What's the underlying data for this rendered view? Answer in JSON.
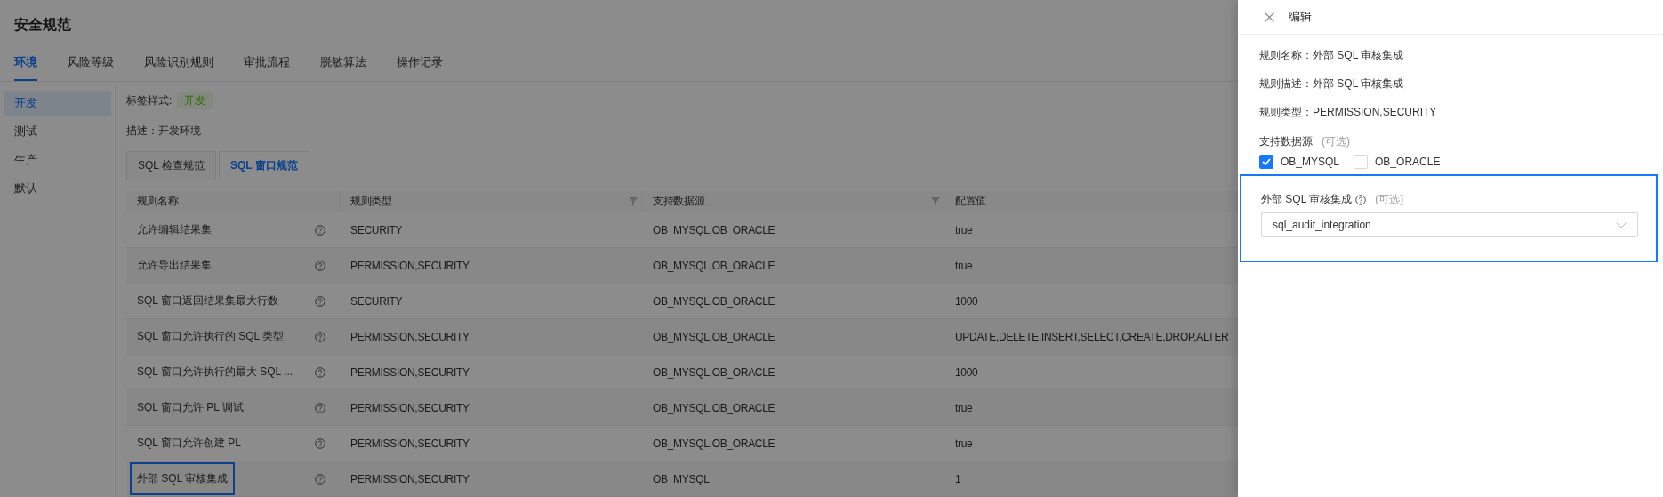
{
  "page": {
    "title": "安全规范"
  },
  "tabs": [
    {
      "label": "环境",
      "selected": true
    },
    {
      "label": "风险等级",
      "selected": false
    },
    {
      "label": "风险识别规则",
      "selected": false
    },
    {
      "label": "审批流程",
      "selected": false
    },
    {
      "label": "脱敏算法",
      "selected": false
    },
    {
      "label": "操作记录",
      "selected": false
    }
  ],
  "sidebar": {
    "items": [
      {
        "label": "开发",
        "selected": true
      },
      {
        "label": "测试",
        "selected": false
      },
      {
        "label": "生产",
        "selected": false
      },
      {
        "label": "默认",
        "selected": false
      }
    ]
  },
  "environment": {
    "tag_label": "标签样式:",
    "tag": "开发",
    "description": "描述：开发环境"
  },
  "sub_tabs": [
    {
      "label": "SQL 检查规范",
      "selected": false
    },
    {
      "label": "SQL 窗口规范",
      "selected": true
    }
  ],
  "table": {
    "columns": [
      {
        "label": "规则名称",
        "filter": false
      },
      {
        "label": "规则类型",
        "filter": true
      },
      {
        "label": "支持数据源",
        "filter": true
      },
      {
        "label": "配置值",
        "filter": false
      }
    ],
    "rows": [
      {
        "name": "允许编辑结果集",
        "type": "SECURITY",
        "sources": "OB_MYSQL,OB_ORACLE",
        "value": "true",
        "highlighted": false
      },
      {
        "name": "允许导出结果集",
        "type": "PERMISSION,SECURITY",
        "sources": "OB_MYSQL,OB_ORACLE",
        "value": "true",
        "highlighted": false
      },
      {
        "name": "SQL 窗口返回结果集最大行数",
        "type": "SECURITY",
        "sources": "OB_MYSQL,OB_ORACLE",
        "value": "1000",
        "highlighted": false
      },
      {
        "name": "SQL 窗口允许执行的 SQL 类型",
        "type": "PERMISSION,SECURITY",
        "sources": "OB_MYSQL,OB_ORACLE",
        "value": "UPDATE,DELETE,INSERT,SELECT,CREATE,DROP,ALTER",
        "highlighted": false
      },
      {
        "name": "SQL 窗口允许执行的最大 SQL ...",
        "type": "PERMISSION,SECURITY",
        "sources": "OB_MYSQL,OB_ORACLE",
        "value": "1000",
        "highlighted": false
      },
      {
        "name": "SQL 窗口允许 PL 调试",
        "type": "PERMISSION,SECURITY",
        "sources": "OB_MYSQL,OB_ORACLE",
        "value": "true",
        "highlighted": false
      },
      {
        "name": "SQL 窗口允许创建 PL",
        "type": "PERMISSION,SECURITY",
        "sources": "OB_MYSQL,OB_ORACLE",
        "value": "true",
        "highlighted": false
      },
      {
        "name": "外部 SQL 审核集成",
        "type": "PERMISSION,SECURITY",
        "sources": "OB_MYSQL",
        "value": "1",
        "highlighted": true
      }
    ]
  },
  "drawer": {
    "title": "编辑",
    "fields": [
      "规则名称：外部 SQL 审核集成",
      "规则描述：外部 SQL 审核集成",
      "规则类型：PERMISSION,SECURITY"
    ],
    "sources": {
      "label": "支持数据源",
      "hint": "(可选)",
      "options": [
        {
          "label": "OB_MYSQL",
          "checked": true
        },
        {
          "label": "OB_ORACLE",
          "checked": false
        }
      ]
    },
    "integration": {
      "label": "外部 SQL 审核集成",
      "hint": "(可选)",
      "value": "sql_audit_integration",
      "highlighted": true
    }
  }
}
